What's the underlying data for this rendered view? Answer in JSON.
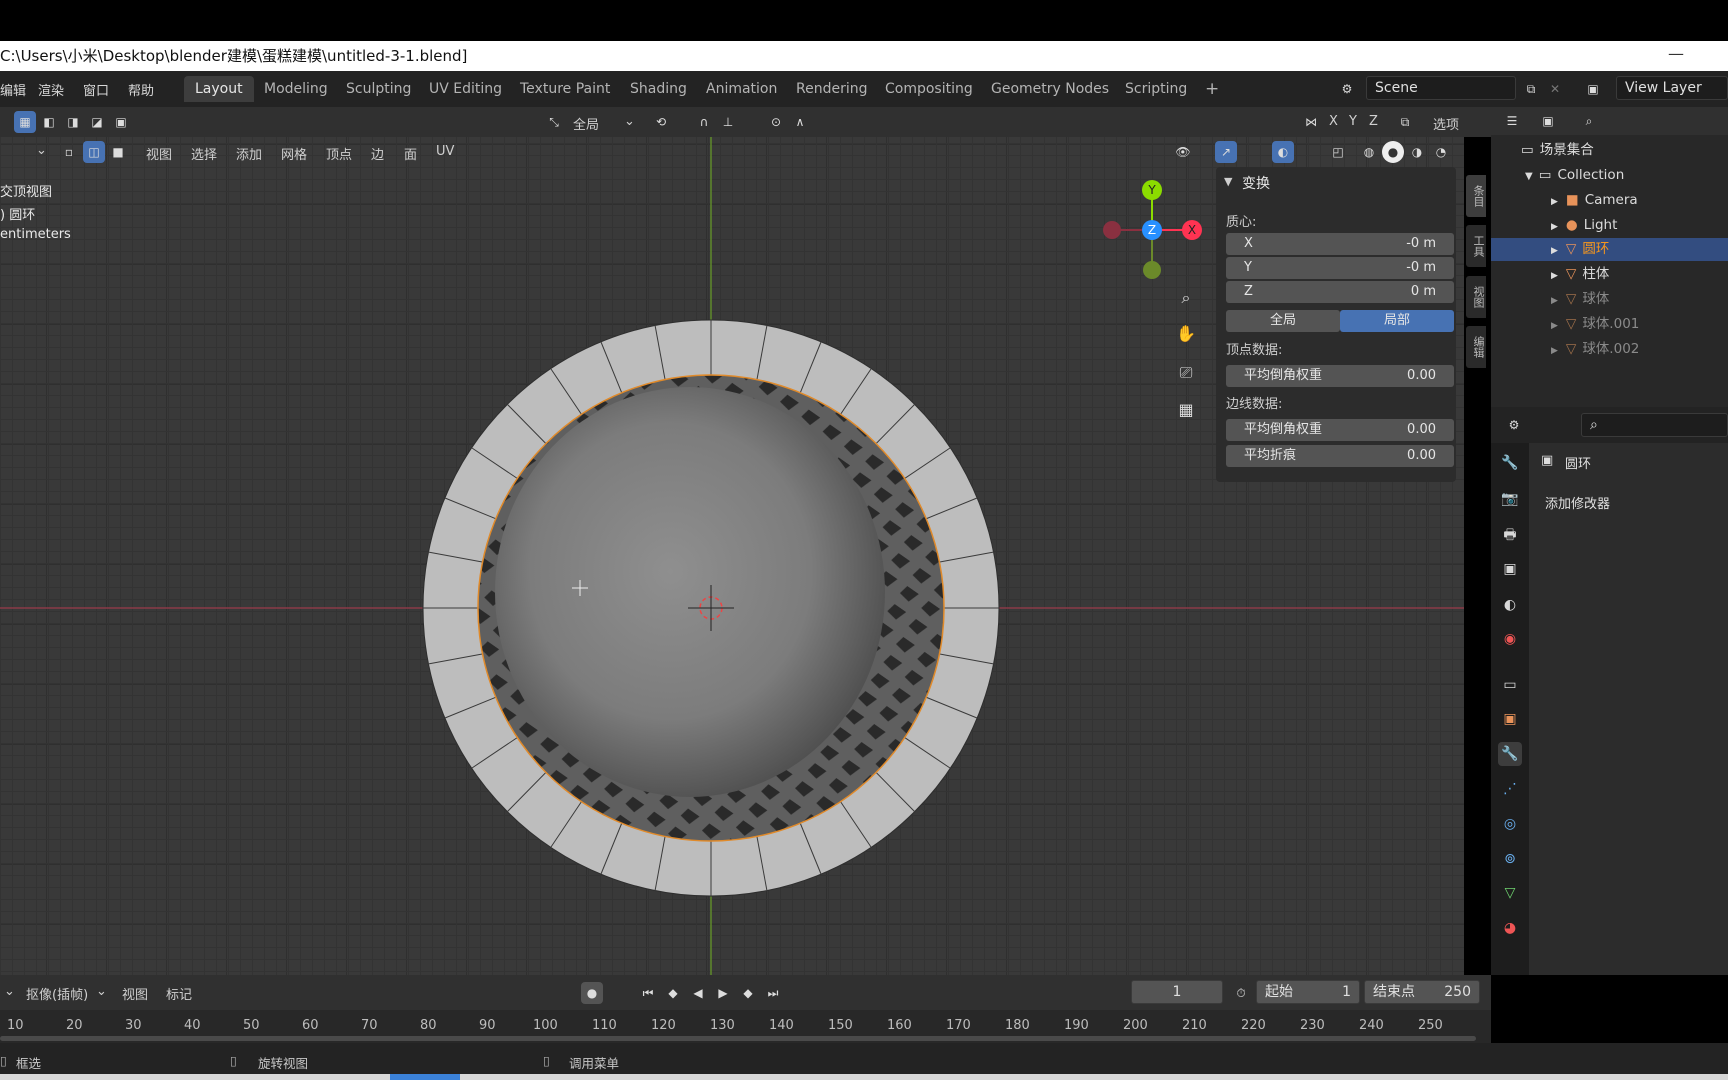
{
  "title": "C:\\Users\\小米\\Desktop\\blender建模\\蛋糕建模\\untitled-3-1.blend]",
  "menu": [
    "编辑",
    "渲染",
    "窗口",
    "帮助"
  ],
  "workspace_tabs": [
    "Layout",
    "Modeling",
    "Sculpting",
    "UV Editing",
    "Texture Paint",
    "Shading",
    "Animation",
    "Rendering",
    "Compositing",
    "Geometry Nodes",
    "Scripting",
    "+"
  ],
  "scene": {
    "label": "Scene"
  },
  "view_layer": {
    "label": "View Layer"
  },
  "viewport_header": {
    "orientation": "全局",
    "menus": [
      "视图",
      "选择",
      "添加",
      "网格",
      "顶点",
      "边",
      "面",
      "UV"
    ],
    "axes": [
      "X",
      "Y",
      "Z"
    ],
    "options": "选项"
  },
  "viewport_info": {
    "line1": "交顶视图",
    "line2": ") 圆环",
    "line3": "entimeters"
  },
  "gizmo": {
    "x": "X",
    "y": "Y",
    "z": "Z"
  },
  "npanel": {
    "title": "变换",
    "median_label": "质心:",
    "x": {
      "label": "X",
      "value": "-0 m"
    },
    "y": {
      "label": "Y",
      "value": "-0 m"
    },
    "z": {
      "label": "Z",
      "value": "0 m"
    },
    "global_btn": "全局",
    "local_btn": "局部",
    "vertex_data": "顶点数据:",
    "vertex_bevel": {
      "label": "平均倒角权重",
      "value": "0.00"
    },
    "edge_data": "边线数据:",
    "edge_bevel": {
      "label": "平均倒角权重",
      "value": "0.00"
    },
    "edge_crease": {
      "label": "平均折痕",
      "value": "0.00"
    },
    "side_tabs": [
      "条目",
      "工具",
      "视图",
      "编辑"
    ]
  },
  "outliner": {
    "root": "场景集合",
    "collection": "Collection",
    "items": [
      {
        "name": "Camera",
        "selected": false,
        "dim": false
      },
      {
        "name": "Light",
        "selected": false,
        "dim": false
      },
      {
        "name": "圆环",
        "selected": true,
        "dim": false
      },
      {
        "name": "柱体",
        "selected": false,
        "dim": false
      },
      {
        "name": "球体",
        "selected": false,
        "dim": true
      },
      {
        "name": "球体.001",
        "selected": false,
        "dim": true
      },
      {
        "name": "球体.002",
        "selected": false,
        "dim": true
      }
    ]
  },
  "properties": {
    "object_name": "圆环",
    "add_modifier": "添加修改器"
  },
  "timeline_header": {
    "mode": "抠像(插帧)",
    "view": "视图",
    "marker": "标记",
    "current_frame": "1",
    "start_label": "起始",
    "start": "1",
    "end_label": "结束点",
    "end": "250"
  },
  "timeline_ticks": [
    "10",
    "20",
    "30",
    "40",
    "50",
    "60",
    "70",
    "80",
    "90",
    "100",
    "110",
    "120",
    "130",
    "140",
    "150",
    "160",
    "170",
    "180",
    "190",
    "200",
    "210",
    "220",
    "230",
    "240",
    "250"
  ],
  "statusbar": {
    "select": "框选",
    "rotate": "旋转视图",
    "menu": "调用菜单"
  },
  "colors": {
    "accent": "#4772b3",
    "selection": "#f5961e",
    "x_axis": "#ff3352",
    "y_axis": "#8bdc00",
    "z_axis": "#2890ff"
  }
}
